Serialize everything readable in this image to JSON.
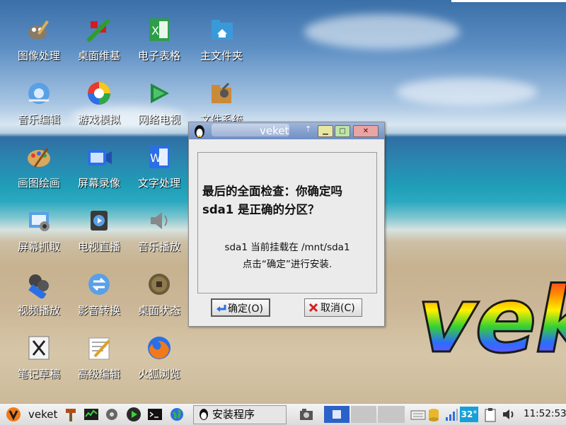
{
  "desktop": {
    "icons": [
      {
        "label": "图像处理",
        "icon": "gimp-icon"
      },
      {
        "label": "桌面维基",
        "icon": "wiki-icon"
      },
      {
        "label": "电子表格",
        "icon": "spreadsheet-icon"
      },
      {
        "label": "主文件夹",
        "icon": "home-folder-icon"
      },
      {
        "label": "音乐编辑",
        "icon": "audio-editor-icon"
      },
      {
        "label": "游戏模拟",
        "icon": "game-emulator-icon"
      },
      {
        "label": "网络电视",
        "icon": "network-tv-icon"
      },
      {
        "label": "文件系统",
        "icon": "filesystem-icon"
      },
      {
        "label": "画图绘画",
        "icon": "paint-icon"
      },
      {
        "label": "屏幕录像",
        "icon": "screen-recorder-icon"
      },
      {
        "label": "文字处理",
        "icon": "word-processor-icon"
      },
      {
        "label": "屏幕抓取",
        "icon": "screenshot-icon"
      },
      {
        "label": "电视直播",
        "icon": "live-tv-icon"
      },
      {
        "label": "音乐播放",
        "icon": "music-player-icon"
      },
      {
        "label": "视频播放",
        "icon": "video-player-icon"
      },
      {
        "label": "影音转换",
        "icon": "media-converter-icon"
      },
      {
        "label": "桌面状态",
        "icon": "desktop-status-icon"
      },
      {
        "label": "笔记草稿",
        "icon": "notes-icon"
      },
      {
        "label": "高级编辑",
        "icon": "text-editor-icon"
      },
      {
        "label": "火狐浏览",
        "icon": "firefox-icon"
      }
    ]
  },
  "dialog": {
    "title": "veket",
    "heading": "最后的全面检查：你确定吗 sda1 是正确的分区？",
    "message_line1": "sda1 当前挂载在  /mnt/sda1",
    "message_line2": "点击“确定”进行安装.",
    "ok_label": "确定(O)",
    "cancel_label": "取消(C)"
  },
  "wallpaper": {
    "logo_text": "veket"
  },
  "taskbar": {
    "menu_label": "veket",
    "task_label": "安装程序",
    "temperature": "32°",
    "clock": "11:52:53"
  },
  "colors": {
    "accent": "#6f8fc4",
    "ok_border": "#5a5a5a",
    "close": "#e9a4a4"
  }
}
